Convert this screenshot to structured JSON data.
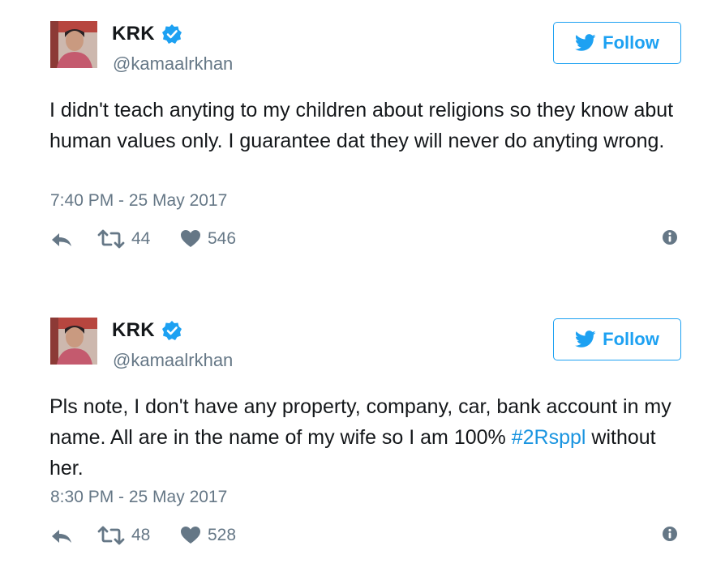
{
  "colors": {
    "twitter_blue": "#1da1f2",
    "hashtag_blue": "#1b95e0",
    "text": "#14171a",
    "muted": "#657786"
  },
  "icons": {
    "verified": "verified-badge-icon",
    "bird": "twitter-bird-icon",
    "reply": "reply-icon",
    "retweet": "retweet-icon",
    "like": "heart-icon",
    "info": "info-icon"
  },
  "tweets": [
    {
      "name": "KRK",
      "handle": "@kamaalrkhan",
      "follow_label": "Follow",
      "text": "I didn't teach anyting to my children about religions so they know abut human values only. I guarantee dat they will never do anyting wrong.",
      "timestamp": "7:40 PM - 25 May 2017",
      "retweets": "44",
      "likes": "546"
    },
    {
      "name": "KRK",
      "handle": "@kamaalrkhan",
      "follow_label": "Follow",
      "text_before": "Pls note, I don't have any property, company, car, bank account in my name. All are in the name of my wife so I am 100%",
      "hashtag": "#2Rsppl",
      "text_after": " without her.",
      "timestamp": "8:30 PM - 25 May 2017",
      "retweets": "48",
      "likes": "528"
    }
  ]
}
